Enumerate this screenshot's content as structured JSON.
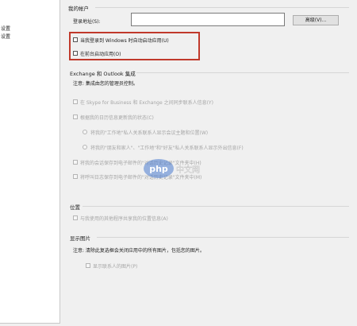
{
  "left_pane": {
    "items": [
      "设置",
      "设置"
    ]
  },
  "account": {
    "section_title": "我的帐户",
    "address_label": "登录地址(S):",
    "address_value": "",
    "advanced_button": "高级(V)...",
    "startup_checkbox": "当我登录到 Windows 时自动启动应用(U)",
    "foreground_checkbox": "在前台启动应用(O)"
  },
  "exchange": {
    "section_title": "Exchange 和 Outlook 集成",
    "note": "注意: 集成由您的管理员控制。",
    "options": [
      "在 Skype for Business 和 Exchange 之间同步联系人信息(Y)",
      "根据我的日历信息更新我的状态(C)",
      "将我的\"工作地\"私人关系联系人显示会议主题和位置(W)",
      "将我的\"朋友和家人\"、\"工作地\"和\"好友\"私人关系联系人显示外出信息(F)",
      "将我的会话保存到电子邮件的\"对话历史记录\"文件夹中(H)",
      "将呼叫日志保存到电子邮件的\"对话历史记录\"文件夹中(M)"
    ]
  },
  "location": {
    "section_title": "位置",
    "option": "与我使用的其他程序共享我的位置信息(A)"
  },
  "photos": {
    "section_title": "显示图片",
    "note": "注意: 清除此复选框会关闭应用中的所有图片，包括您的图片。",
    "option": "显示联系人的图片(P)"
  },
  "watermark": {
    "text": "php中文网",
    "logo": "php"
  },
  "colors": {
    "highlight_border": "#c0392b",
    "watermark_blue": "#4a7bd0"
  }
}
